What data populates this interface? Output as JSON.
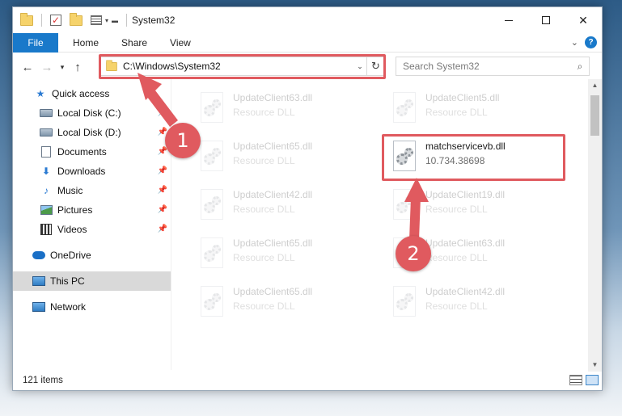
{
  "window": {
    "title": "System32"
  },
  "ribbon": {
    "file": "File",
    "home": "Home",
    "share": "Share",
    "view": "View",
    "help": "?"
  },
  "address": {
    "path": "C:\\Windows\\System32",
    "search_placeholder": "Search System32"
  },
  "nav": {
    "quick_access": "Quick access",
    "items": [
      {
        "label": "Local Disk (C:)",
        "icon": "drive-icon",
        "pinned": true
      },
      {
        "label": "Local Disk (D:)",
        "icon": "drive-icon",
        "pinned": true
      },
      {
        "label": "Documents",
        "icon": "documents-icon",
        "pinned": true
      },
      {
        "label": "Downloads",
        "icon": "downloads-icon",
        "pinned": true
      },
      {
        "label": "Music",
        "icon": "music-icon",
        "pinned": true
      },
      {
        "label": "Pictures",
        "icon": "pictures-icon",
        "pinned": true
      },
      {
        "label": "Videos",
        "icon": "videos-icon",
        "pinned": true
      }
    ],
    "onedrive": "OneDrive",
    "this_pc": "This PC",
    "network": "Network"
  },
  "files": [
    {
      "name": "UpdateClient63.dll",
      "desc": "Resource DLL"
    },
    {
      "name": "UpdateClient5.dll",
      "desc": "Resource DLL"
    },
    {
      "name": "UpdateClient65.dll",
      "desc": "Resource DLL"
    },
    {
      "name": "matchservicevb.dll",
      "desc": "10.734.38698"
    },
    {
      "name": "UpdateClient42.dll",
      "desc": "Resource DLL"
    },
    {
      "name": "UpdateClient19.dll",
      "desc": "Resource DLL"
    },
    {
      "name": "UpdateClient65.dll",
      "desc": "Resource DLL"
    },
    {
      "name": "UpdateClient63.dll",
      "desc": "Resource DLL"
    },
    {
      "name": "UpdateClient65.dll",
      "desc": "Resource DLL"
    },
    {
      "name": "UpdateClient42.dll",
      "desc": "Resource DLL"
    }
  ],
  "status": {
    "count": "121 items"
  },
  "annotations": {
    "step1": "1",
    "step2": "2",
    "color": "#e05a5f"
  }
}
